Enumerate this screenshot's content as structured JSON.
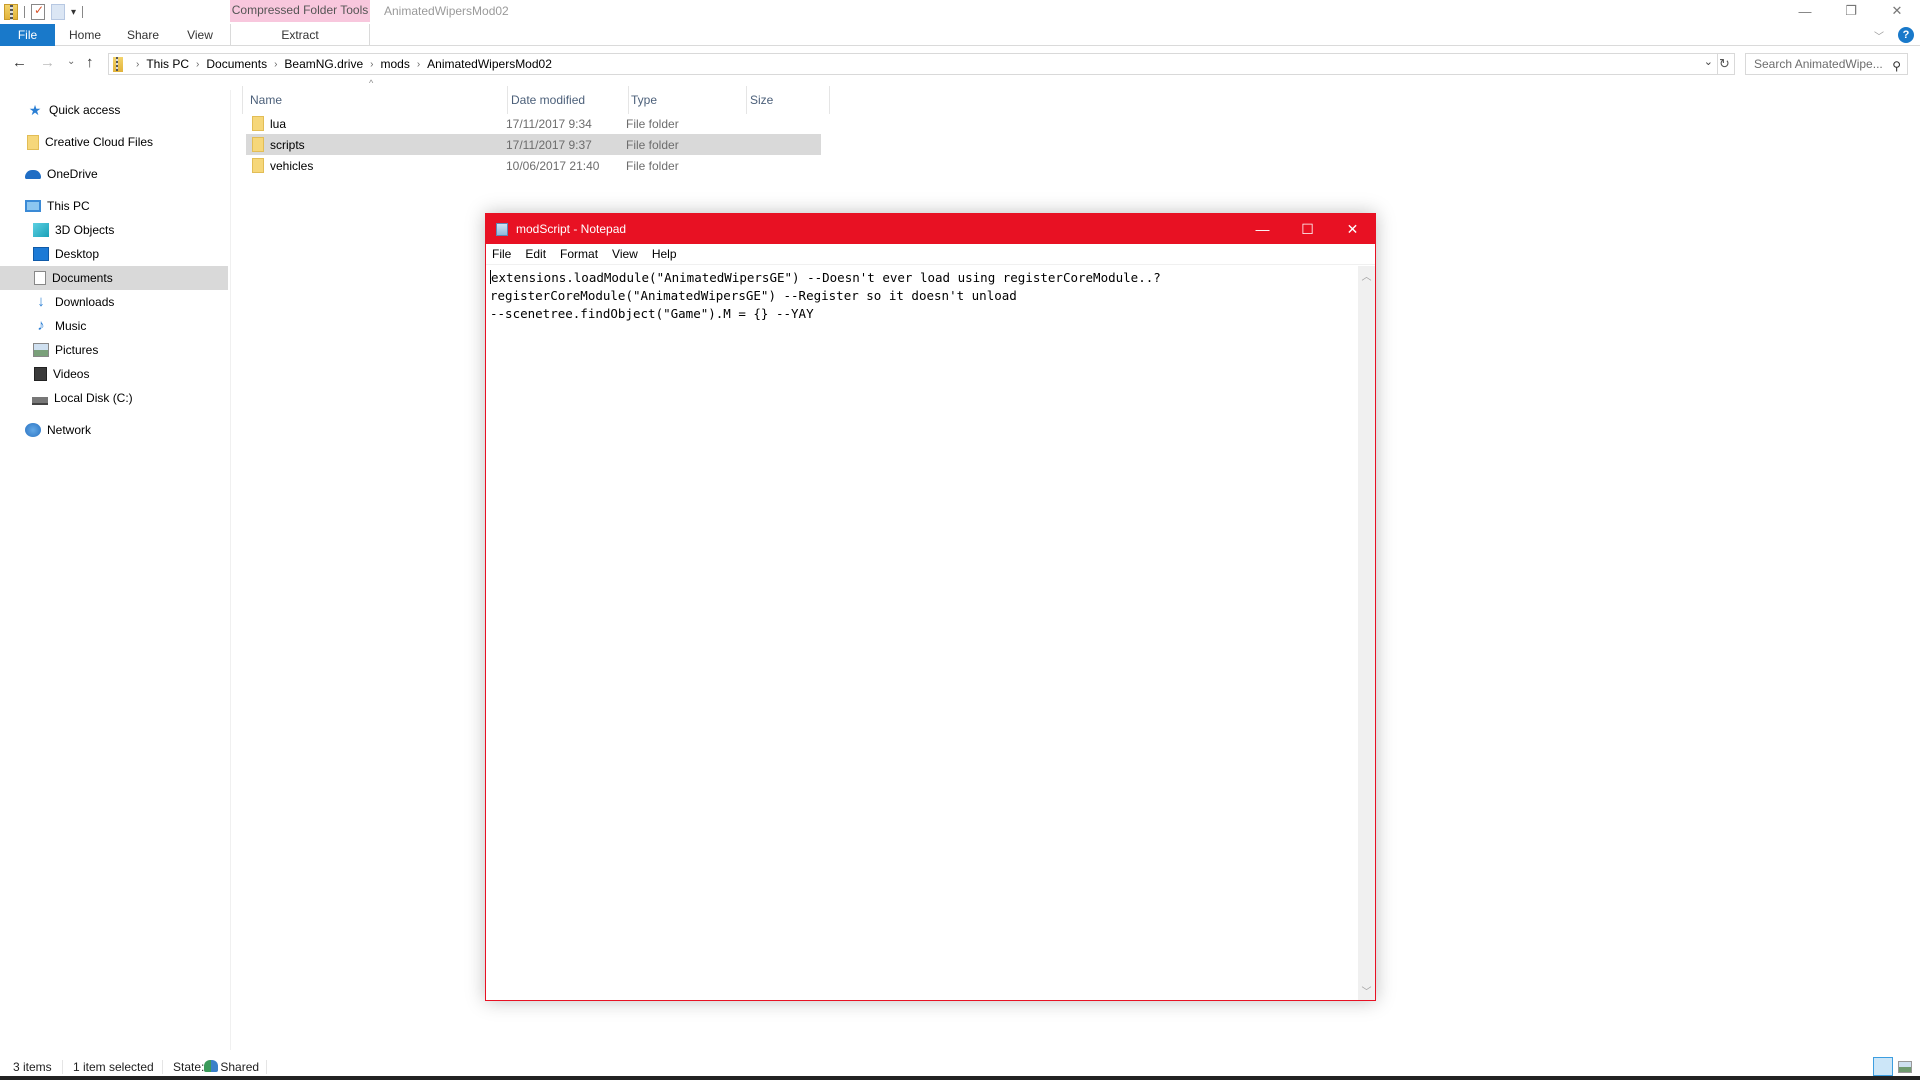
{
  "explorer": {
    "window_title": "AnimatedWipersMod02",
    "context_tab_group": "Compressed Folder Tools",
    "ribbon_tabs": [
      "File",
      "Home",
      "Share",
      "View"
    ],
    "context_tab": "Extract",
    "window_controls": {
      "minimize": "—",
      "restore": "❐",
      "close": "✕"
    },
    "help_icon": "?",
    "breadcrumb": [
      "This PC",
      "Documents",
      "BeamNG.drive",
      "mods",
      "AnimatedWipersMod02"
    ],
    "search_placeholder": "Search AnimatedWipe...",
    "nav": {
      "back": "←",
      "forward": "→",
      "recent": "⌄",
      "up": "↑",
      "refresh": "↻"
    },
    "sidebar": [
      {
        "label": "Quick access",
        "icon": "quick-access-star-icon"
      },
      {
        "label": "Creative Cloud Files",
        "icon": "folder-icon"
      },
      {
        "label": "OneDrive",
        "icon": "onedrive-cloud-icon"
      },
      {
        "label": "This PC",
        "icon": "computer-icon"
      },
      {
        "label": "3D Objects",
        "icon": "3d-objects-icon"
      },
      {
        "label": "Desktop",
        "icon": "desktop-icon"
      },
      {
        "label": "Documents",
        "icon": "documents-icon",
        "selected": true
      },
      {
        "label": "Downloads",
        "icon": "downloads-arrow-icon"
      },
      {
        "label": "Music",
        "icon": "music-note-icon"
      },
      {
        "label": "Pictures",
        "icon": "pictures-icon"
      },
      {
        "label": "Videos",
        "icon": "videos-icon"
      },
      {
        "label": "Local Disk (C:)",
        "icon": "disk-drive-icon"
      },
      {
        "label": "Network",
        "icon": "network-icon"
      }
    ],
    "columns": [
      "Name",
      "Date modified",
      "Type",
      "Size"
    ],
    "files": [
      {
        "name": "lua",
        "date": "17/11/2017 9:34",
        "type": "File folder",
        "size": ""
      },
      {
        "name": "scripts",
        "date": "17/11/2017 9:37",
        "type": "File folder",
        "size": "",
        "selected": true
      },
      {
        "name": "vehicles",
        "date": "10/06/2017 21:40",
        "type": "File folder",
        "size": ""
      }
    ],
    "status": {
      "items": "3 items",
      "selected": "1 item selected",
      "state_label": "State:",
      "state_value": "Shared"
    }
  },
  "notepad": {
    "title": "modScript - Notepad",
    "menu": [
      "File",
      "Edit",
      "Format",
      "View",
      "Help"
    ],
    "controls": {
      "minimize": "—",
      "maximize": "☐",
      "close": "✕"
    },
    "lines": [
      "extensions.loadModule(\"AnimatedWipersGE\") --Doesn't ever load using registerCoreModule..?",
      "registerCoreModule(\"AnimatedWipersGE\") --Register so it doesn't unload",
      "--scenetree.findObject(\"Game\").M = {} --YAY"
    ],
    "accent_color": "#e81123"
  }
}
